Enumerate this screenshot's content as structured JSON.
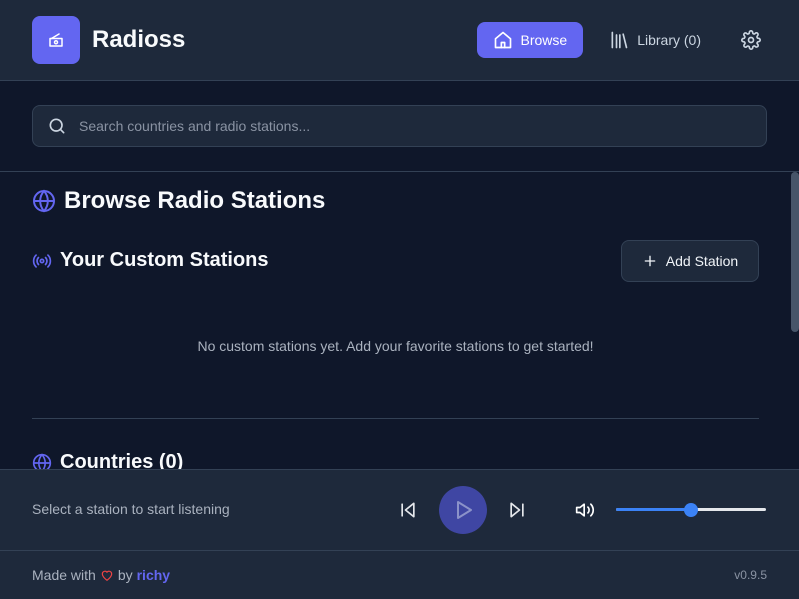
{
  "app": {
    "title": "Radioss"
  },
  "header": {
    "nav": {
      "browse_label": "Browse",
      "library_label": "Library (0)"
    }
  },
  "search": {
    "placeholder": "Search countries and radio stations...",
    "value": ""
  },
  "main": {
    "page_title": "Browse Radio Stations",
    "custom_section": {
      "title": "Your Custom Stations",
      "add_label": "Add Station",
      "empty_message": "No custom stations yet. Add your favorite stations to get started!"
    },
    "countries_section": {
      "title": "Countries (0)"
    }
  },
  "player": {
    "status": "Select a station to start listening",
    "volume": 0.5
  },
  "footer": {
    "made_with": "Made with",
    "by": "by",
    "author": "richy",
    "version": "v0.9.5"
  },
  "colors": {
    "accent": "#6366f1",
    "background": "#0f172a",
    "panel": "#1e293b",
    "slider": "#3b82f6",
    "heart": "#ef4444"
  },
  "icons": {
    "logo": "radio-icon",
    "browse": "home-icon",
    "library": "library-icon",
    "settings": "gear-icon",
    "search": "search-icon",
    "title": "globe-icon",
    "custom": "broadcast-icon",
    "add": "plus-icon",
    "countries": "globe-icon",
    "prev": "skip-back-icon",
    "play": "play-icon",
    "next": "skip-forward-icon",
    "volume": "volume-icon",
    "heart": "heart-icon"
  }
}
